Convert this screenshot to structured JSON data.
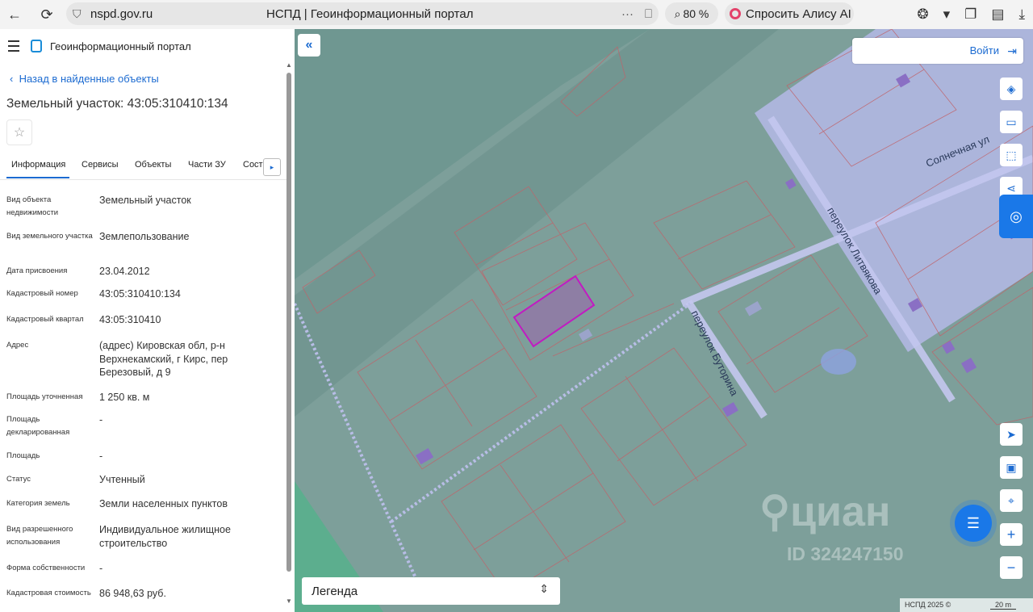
{
  "browser": {
    "url": "nspd.gov.ru",
    "tab_title": "НСПД | Геоинформационный портал",
    "zoom": "80 %",
    "alice": "Спросить Алису AI",
    "more": "···"
  },
  "sidebar": {
    "app_name": "Геоинформационный портал",
    "back_link": "Назад в найденные объекты",
    "title": "Земельный участок: 43:05:310410:134",
    "tabs": [
      "Информация",
      "Сервисы",
      "Объекты",
      "Части ЗУ",
      "Сост"
    ],
    "fields": [
      {
        "label": "Вид объекта недвижимости",
        "value": "Земельный участок"
      },
      {
        "label": "Вид земельного участка",
        "value": "Землепользование"
      },
      {
        "label": "Дата присвоения",
        "value": "23.04.2012"
      },
      {
        "label": "Кадастровый номер",
        "value": "43:05:310410:134"
      },
      {
        "label": "Кадастровый квартал",
        "value": "43:05:310410"
      },
      {
        "label": "Адрес",
        "value": "(адрес) Кировская обл, р-н Верхнекамский, г Кирс, пер Березовый, д 9"
      },
      {
        "label": "Площадь уточненная",
        "value": "1 250 кв. м"
      },
      {
        "label": "Площадь декларированная",
        "value": "-"
      },
      {
        "label": "Площадь",
        "value": "-"
      },
      {
        "label": "Статус",
        "value": "Учтенный"
      },
      {
        "label": "Категория земель",
        "value": "Земли населенных пунктов"
      },
      {
        "label": "Вид разрешенного использования",
        "value": "Индивидуальное жилищное строительство"
      },
      {
        "label": "Форма собственности",
        "value": "-"
      },
      {
        "label": "Кадастровая стоимость",
        "value": "86 948,63 руб."
      }
    ]
  },
  "map": {
    "login": "Войти",
    "legend": "Легенда",
    "streets": [
      "Солнечная ул",
      "переулок Литвякова",
      "переулок Буторина"
    ],
    "watermark": "циан",
    "watermark_id": "ID 324247150",
    "copyright": "НСПД 2025 ©",
    "scale": "20 m",
    "colors": {
      "highlight": "#c21ac2",
      "parcel_border": "#c0636a",
      "residential": "#b4b8e6"
    }
  }
}
